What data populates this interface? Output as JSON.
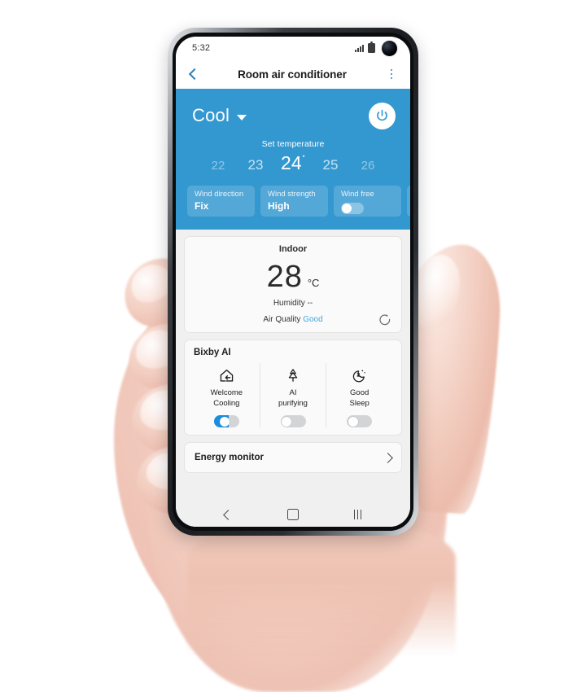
{
  "status_bar": {
    "time": "5:32",
    "signal_icon": "signal-bars-icon",
    "battery_icon": "battery-icon",
    "camera_icon": "front-camera-punch-hole"
  },
  "title_bar": {
    "back_icon": "chevron-left-icon",
    "title": "Room air conditioner",
    "menu_icon": "more-options-icon"
  },
  "control_panel": {
    "mode": "Cool",
    "mode_caret_icon": "chevron-down-icon",
    "power_icon": "power-icon",
    "accent_color": "#3498d0",
    "set_temperature_label": "Set temperature",
    "temperatures": [
      "22",
      "23",
      "24",
      "25",
      "26"
    ],
    "selected_temperature": "24",
    "degree_symbol": "˚",
    "tiles": [
      {
        "label": "Wind direction",
        "value": "Fix",
        "type": "value"
      },
      {
        "label": "Wind strength",
        "value": "High",
        "type": "value"
      },
      {
        "label": "Wind free",
        "value": "",
        "type": "toggle",
        "toggle_on": false
      }
    ]
  },
  "indoor_card": {
    "title": "Indoor",
    "temperature": "28",
    "unit": "°C",
    "humidity_line": "Humidity --",
    "air_quality_label": "Air Quality",
    "air_quality_value": "Good",
    "air_quality_color": "#49a5dd",
    "refresh_icon": "refresh-icon"
  },
  "bixby_card": {
    "title": "Bixby AI",
    "features": [
      {
        "label_line1": "Welcome",
        "label_line2": "Cooling",
        "icon": "home-arrow-in-icon",
        "toggle_on": true
      },
      {
        "label_line1": "AI",
        "label_line2": "purifying",
        "icon": "tree-icon",
        "toggle_on": false
      },
      {
        "label_line1": "Good",
        "label_line2": "Sleep",
        "icon": "moon-sleep-icon",
        "toggle_on": false
      }
    ]
  },
  "energy_card": {
    "label": "Energy monitor",
    "chevron_icon": "chevron-right-icon"
  },
  "nav_bar": {
    "back_icon": "nav-back-icon",
    "home_icon": "nav-home-icon",
    "recents_icon": "nav-recents-icon"
  }
}
